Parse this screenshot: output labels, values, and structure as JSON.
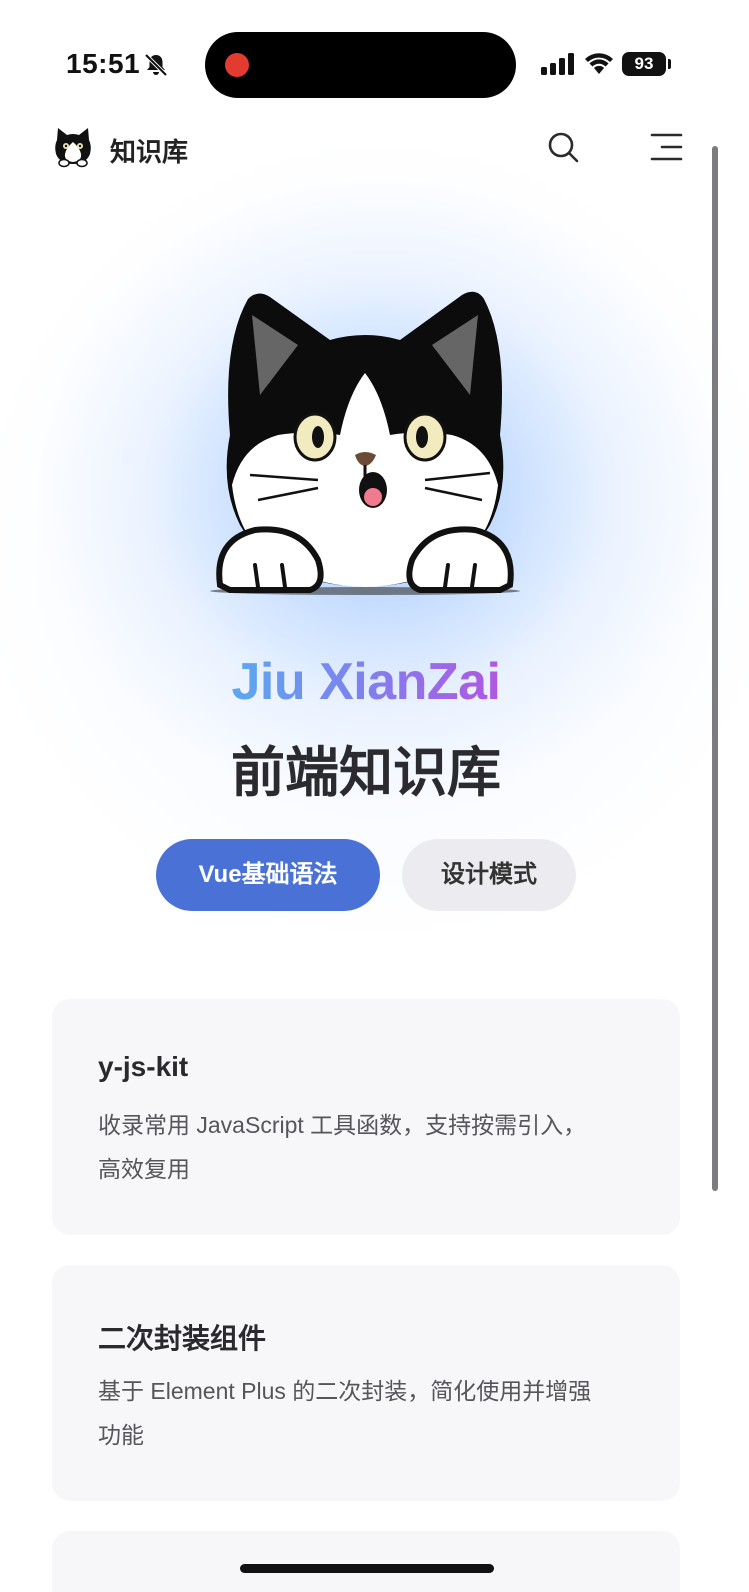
{
  "status_bar": {
    "time": "15:51",
    "battery": "93",
    "icons": [
      "bell-muted-icon",
      "signal-icon",
      "wifi-icon",
      "battery-icon"
    ],
    "recording_color": "#e33b2f"
  },
  "header": {
    "title": "知识库",
    "logo_icon": "cat-logo-icon",
    "search_icon": "search-icon",
    "menu_icon": "menu-icon"
  },
  "hero": {
    "brand": "Jiu XianZai",
    "subtitle": "前端知识库",
    "image_icon": "cat-mascot",
    "primary_button": "Vue基础语法",
    "secondary_button": "设计模式",
    "accent_color": "#4a72d6",
    "gradient_colors": [
      "#5aa9ee",
      "#7d83ef",
      "#b157e0"
    ]
  },
  "features": [
    {
      "title": "y-js-kit",
      "desc_line1": "收录常用 JavaScript 工具函数，支持按需引入，",
      "desc_line2": "高效复用"
    },
    {
      "title": "二次封装组件",
      "desc_line1": "基于 Element Plus 的二次封装，简化使用并增强",
      "desc_line2": "功能"
    }
  ]
}
